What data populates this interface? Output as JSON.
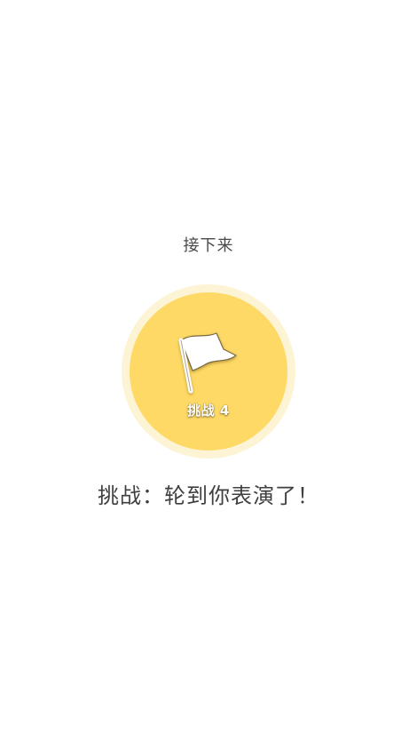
{
  "header": {
    "next_label": "接下来"
  },
  "badge": {
    "icon": "flag-icon",
    "label": "挑战 4",
    "fill_color": "#fed966",
    "halo_color": "#fdf4d6"
  },
  "main": {
    "challenge_text": "挑战：轮到你表演了！"
  }
}
